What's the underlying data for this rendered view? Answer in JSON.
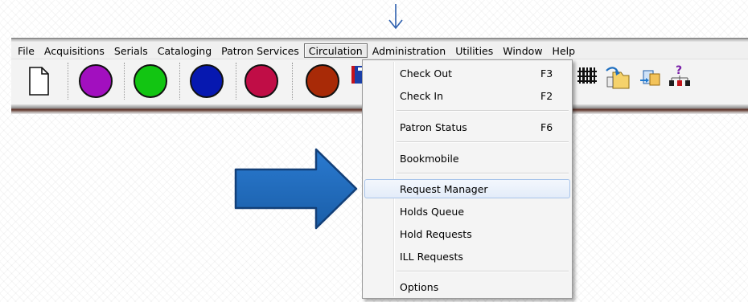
{
  "menubar": {
    "items": [
      {
        "label": "File"
      },
      {
        "label": "Acquisitions"
      },
      {
        "label": "Serials"
      },
      {
        "label": "Cataloging"
      },
      {
        "label": "Patron Services"
      },
      {
        "label": "Circulation"
      },
      {
        "label": "Administration"
      },
      {
        "label": "Utilities"
      },
      {
        "label": "Window"
      },
      {
        "label": "Help"
      }
    ]
  },
  "toolbar": {
    "buttons": [
      {
        "icon": "new-document-icon"
      },
      {
        "icon": "purple-circle-icon",
        "color": "#a20fbf"
      },
      {
        "icon": "green-circle-icon",
        "color": "#12c512"
      },
      {
        "icon": "blue-circle-icon",
        "color": "#0618b0"
      },
      {
        "icon": "crimson-circle-icon",
        "color": "#c00d46"
      },
      {
        "icon": "brown-circle-icon",
        "color": "#a82a07"
      },
      {
        "icon": "flag-icon"
      },
      {
        "icon": "barcode-grid-icon"
      },
      {
        "icon": "folder-transfer-icon"
      },
      {
        "icon": "document-transfer-icon"
      },
      {
        "icon": "help-hierarchy-icon"
      }
    ]
  },
  "circulation_menu": {
    "items": [
      {
        "label": "Check Out",
        "shortcut": "F3"
      },
      {
        "label": "Check In",
        "shortcut": "F2"
      },
      {
        "label": "Patron Status",
        "shortcut": "F6"
      },
      {
        "label": "Bookmobile",
        "shortcut": ""
      },
      {
        "label": "Request Manager",
        "shortcut": "",
        "highlighted": true
      },
      {
        "label": "Holds Queue",
        "shortcut": ""
      },
      {
        "label": "Hold Requests",
        "shortcut": ""
      },
      {
        "label": "ILL Requests",
        "shortcut": ""
      },
      {
        "label": "Options",
        "shortcut": ""
      }
    ]
  },
  "annotations": {
    "big_arrow_color": "#1f66b3",
    "small_arrow_color": "#2d5fae"
  }
}
